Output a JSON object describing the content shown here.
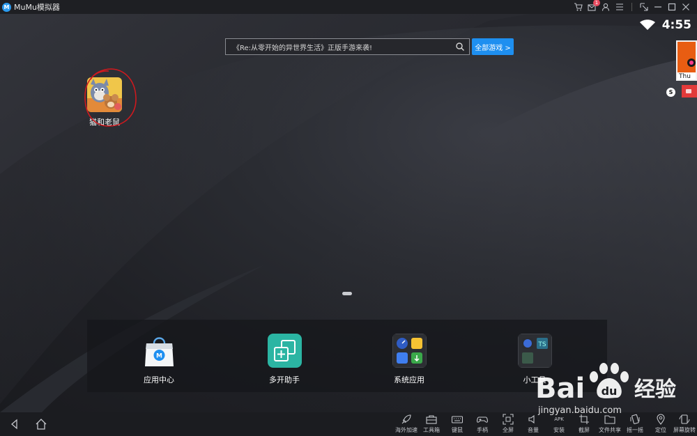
{
  "window": {
    "title": "MuMu模拟器",
    "logo_letter": "M",
    "notification_count": "1"
  },
  "status_bar": {
    "time": "4:55"
  },
  "search": {
    "placeholder": "《Re:从零开始的异世界生活》正版手游来袭!",
    "button_label": "全部游戏 >"
  },
  "desktop_apps": [
    {
      "label": "猫和老鼠",
      "icon": "tom-and-jerry-game-icon"
    }
  ],
  "side_widget": {
    "label": "Thu",
    "badge": "S"
  },
  "dock": [
    {
      "label": "应用中心",
      "icon": "app-center-icon"
    },
    {
      "label": "多开助手",
      "icon": "multi-instance-icon"
    },
    {
      "label": "系统应用",
      "icon": "system-apps-folder-icon"
    },
    {
      "label": "小工具",
      "icon": "tools-folder-icon"
    }
  ],
  "toolbar": [
    {
      "label": "海外加速",
      "icon": "rocket-icon"
    },
    {
      "label": "工具箱",
      "icon": "toolbox-icon"
    },
    {
      "label": "键鼠",
      "icon": "keyboard-icon"
    },
    {
      "label": "手柄",
      "icon": "gamepad-icon"
    },
    {
      "label": "全屏",
      "icon": "fullscreen-icon"
    },
    {
      "label": "音量",
      "icon": "volume-icon"
    },
    {
      "label": "安装",
      "icon": "apk-install-icon",
      "icon_text": "APK"
    },
    {
      "label": "截屏",
      "icon": "screenshot-icon"
    },
    {
      "label": "文件共享",
      "icon": "folder-icon"
    },
    {
      "label": "摇一摇",
      "icon": "shake-icon"
    },
    {
      "label": "定位",
      "icon": "location-icon"
    },
    {
      "label": "屏幕旋转",
      "icon": "rotate-icon"
    }
  ],
  "watermark": {
    "brand": "Bai du 经验",
    "url": "jingyan.baidu.com"
  },
  "colors": {
    "accent": "#1e8ff0",
    "annotation_red": "#d0191e"
  }
}
